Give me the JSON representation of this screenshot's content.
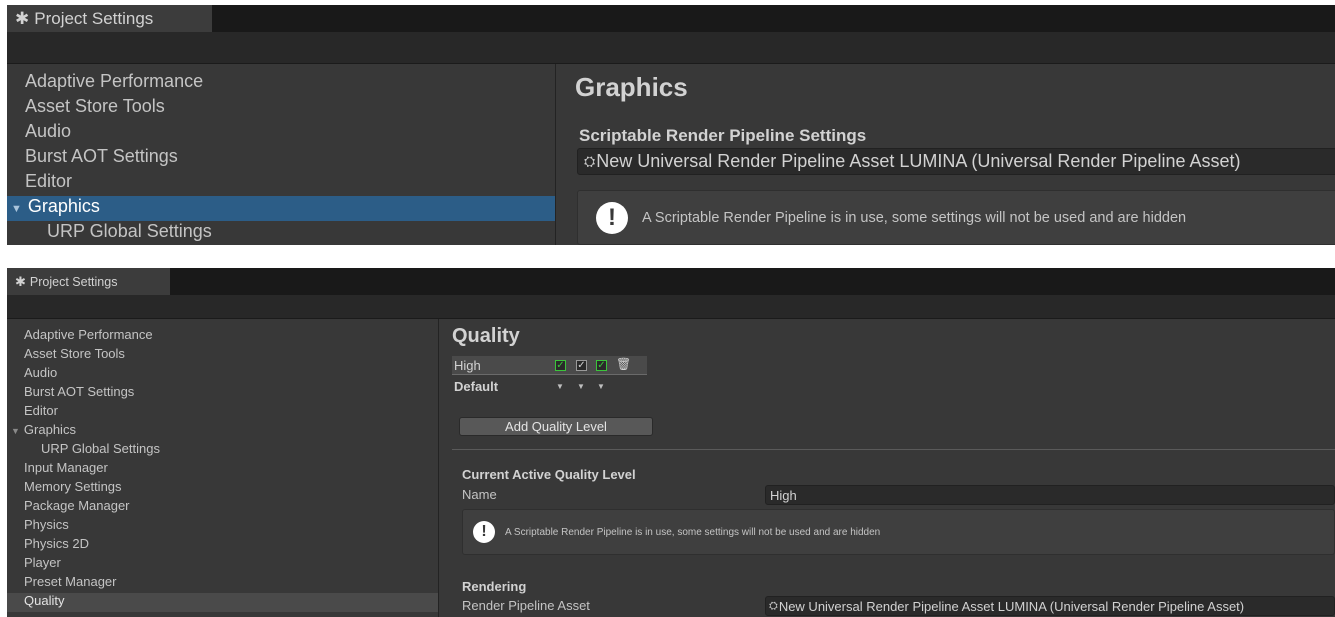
{
  "window": {
    "tab_title": "Project Settings",
    "tab_icon": "gear-icon"
  },
  "top": {
    "sidebar": {
      "items": [
        {
          "label": "Adaptive Performance"
        },
        {
          "label": "Asset Store Tools"
        },
        {
          "label": "Audio"
        },
        {
          "label": "Burst AOT Settings"
        },
        {
          "label": "Editor"
        },
        {
          "label": "Graphics",
          "expanded": true,
          "selected": true
        },
        {
          "label": "URP Global Settings",
          "child": true
        }
      ]
    },
    "content": {
      "title": "Graphics",
      "section_title": "Scriptable Render Pipeline Settings",
      "pipeline_asset": "New Universal Render Pipeline Asset LUMINA (Universal Render Pipeline Asset)",
      "help_text": "A Scriptable Render Pipeline is in use, some settings will not be used and are hidden"
    }
  },
  "bottom": {
    "sidebar": {
      "items": [
        {
          "label": "Adaptive Performance"
        },
        {
          "label": "Asset Store Tools"
        },
        {
          "label": "Audio"
        },
        {
          "label": "Burst AOT Settings"
        },
        {
          "label": "Editor"
        },
        {
          "label": "Graphics",
          "expanded": true
        },
        {
          "label": "URP Global Settings",
          "child": true
        },
        {
          "label": "Input Manager"
        },
        {
          "label": "Memory Settings"
        },
        {
          "label": "Package Manager"
        },
        {
          "label": "Physics"
        },
        {
          "label": "Physics 2D"
        },
        {
          "label": "Player"
        },
        {
          "label": "Preset Manager"
        },
        {
          "label": "Quality",
          "selected": true
        }
      ]
    },
    "content": {
      "title": "Quality",
      "levels": [
        {
          "name": "High",
          "checks": [
            true,
            true,
            true
          ],
          "check_colors": [
            "green",
            "white",
            "green"
          ]
        }
      ],
      "default_label": "Default",
      "add_button": "Add Quality Level",
      "current_section": "Current Active Quality Level",
      "name_label": "Name",
      "name_value": "High",
      "help_text": "A Scriptable Render Pipeline is in use, some settings will not be used and are hidden",
      "rendering_section": "Rendering",
      "rpa_label": "Render Pipeline Asset",
      "rpa_value": "New Universal Render Pipeline Asset LUMINA (Universal Render Pipeline Asset)"
    }
  },
  "colors": {
    "panel_bg": "#383838",
    "selection_blue": "#2c5d87",
    "selection_gray": "#4a4a4a",
    "check_green": "#3bc43b"
  }
}
